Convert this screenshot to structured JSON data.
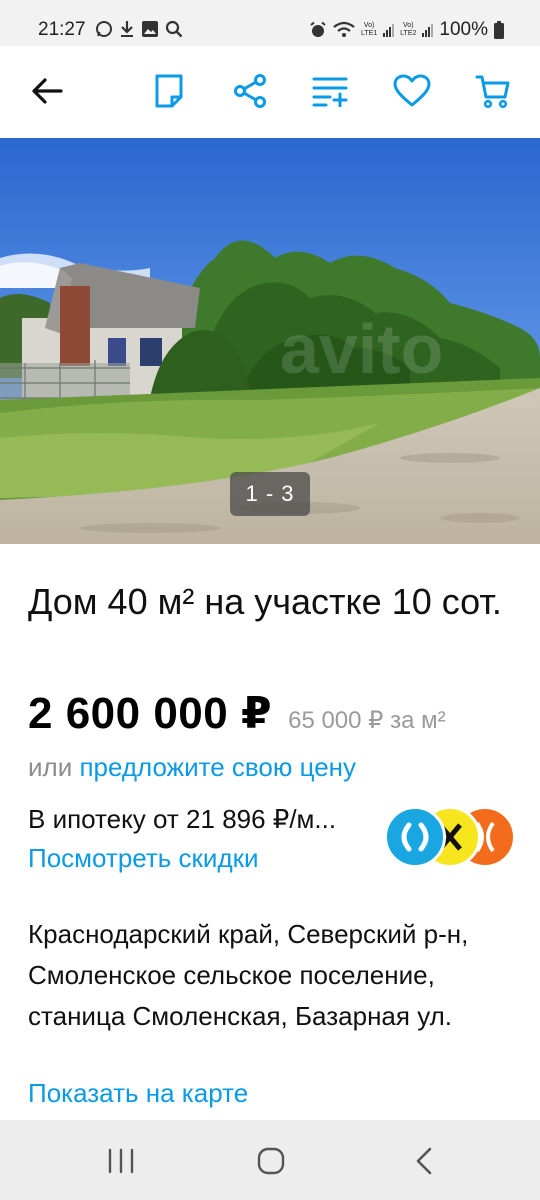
{
  "status_bar": {
    "time": "21:27",
    "battery": "100%",
    "lte1": "LTE1",
    "lte2": "LTE2",
    "volte": "Vo)",
    "icons": [
      "whatsapp-icon",
      "download-icon",
      "gallery-icon",
      "search-icon",
      "alarm-icon",
      "wifi-icon",
      "signal-icon",
      "battery-icon"
    ]
  },
  "app_bar": {
    "icons": [
      "back-arrow-icon",
      "note-icon",
      "share-icon",
      "compare-icon",
      "heart-icon",
      "cart-icon"
    ],
    "accent": "#0a9ae6"
  },
  "gallery": {
    "counter": "1 - 3"
  },
  "listing": {
    "title": "Дом 40 м² на участке 10 сот.",
    "price": "2 600 000 ₽",
    "price_per_m2": "65 000 ₽ за м²",
    "offer_prefix": "или",
    "offer_link": "предложите свою цену",
    "mortgage": "В ипотеку от 21 896 ₽/м...",
    "discounts_link": "Посмотреть скидки",
    "bank_colors": [
      "#1aa6e0",
      "#f7e51d",
      "#f26c1c"
    ],
    "address": "Краснодарский край, Северский р-н, Смоленское сельское поселение, станица Смоленская, Базарная ул.",
    "map_link": "Показать на карте"
  },
  "nav_bar": {
    "icons": [
      "recent-apps-icon",
      "home-icon",
      "back-icon"
    ]
  }
}
